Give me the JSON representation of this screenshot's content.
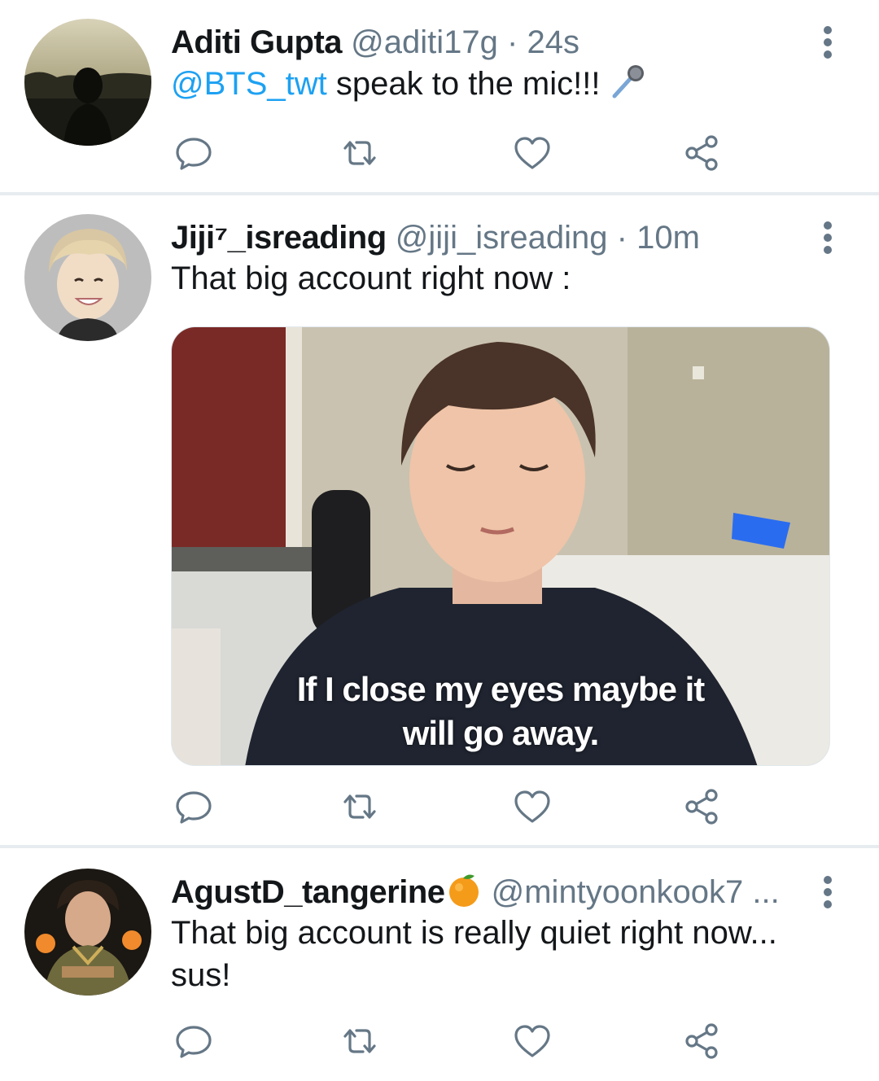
{
  "colors": {
    "accent": "#1da1f2",
    "muted": "#657786",
    "divider": "#e6ecf0",
    "text": "#14171a"
  },
  "action_icons": [
    "reply-icon",
    "retweet-icon",
    "like-icon",
    "share-icon"
  ],
  "tweets": [
    {
      "name": "Aditi Gupta",
      "handle": "@aditi17g",
      "separator": "·",
      "time": "24s",
      "mention": "@BTS_twt",
      "text": " speak to the mic!!! ",
      "emoji": "microphone-icon"
    },
    {
      "name": "Jiji⁷_isreading",
      "handle": "@jiji_isreading",
      "separator": "·",
      "time": "10m",
      "text": "That big account right now :",
      "media_caption_line1": "If I close my eyes maybe it",
      "media_caption_line2": "will go away."
    },
    {
      "name": "AgustD_tangerine",
      "name_emoji": "tangerine-icon",
      "handle": "@mintyoonkook7",
      "ellipsis": "...",
      "text": "That big account is really quiet right now... sus!"
    }
  ]
}
